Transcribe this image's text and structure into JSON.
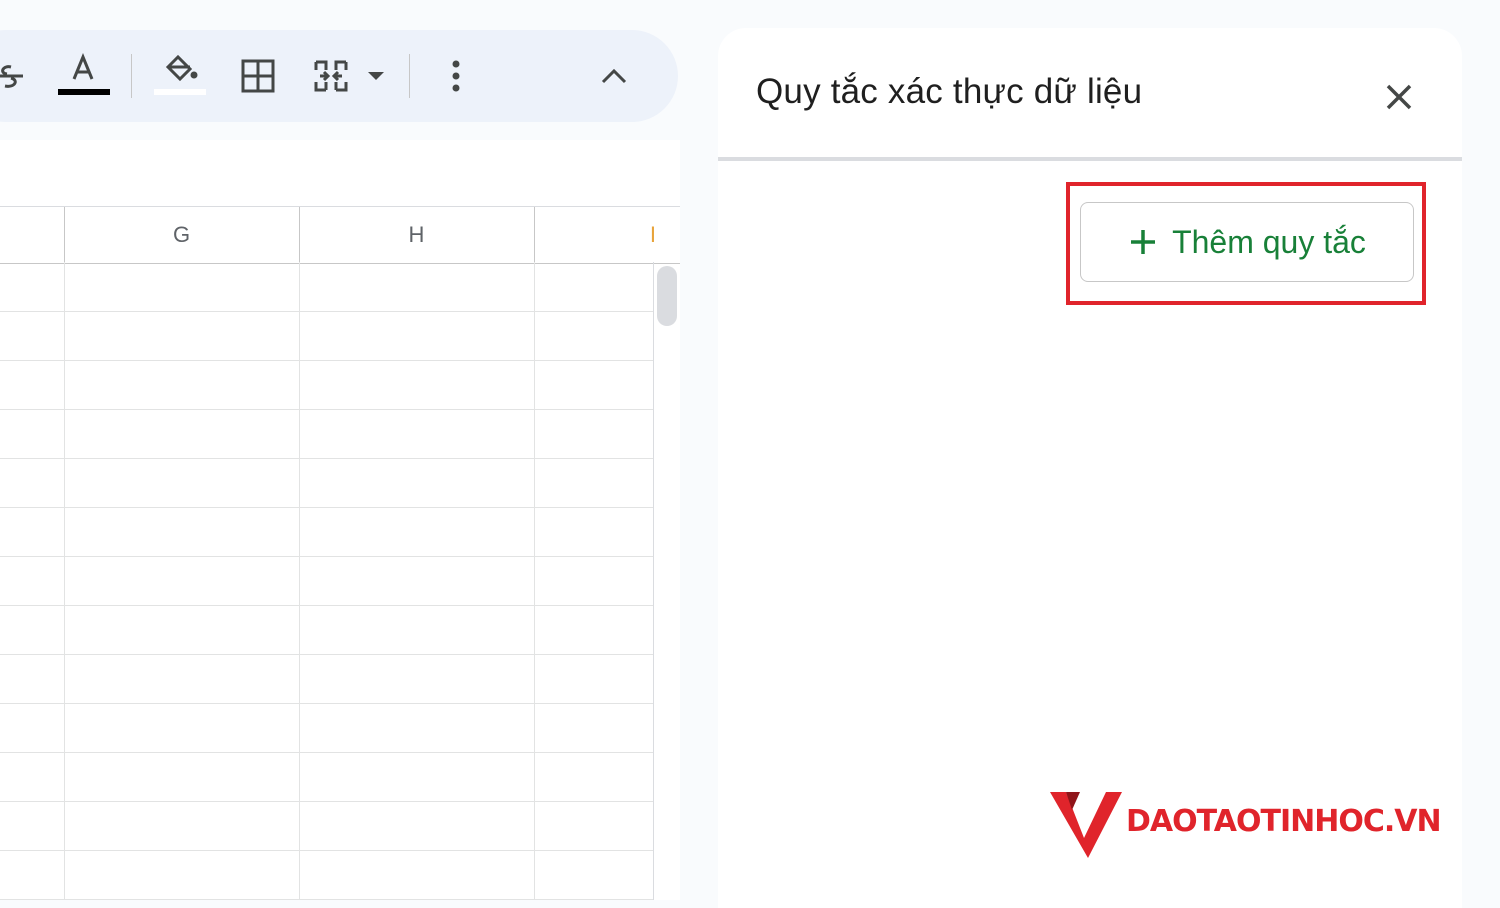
{
  "grid": {
    "columns": [
      "G",
      "H",
      "I"
    ]
  },
  "panel": {
    "title": "Quy tắc xác thực dữ liệu",
    "add_rule_label": "Thêm quy tắc"
  },
  "logo": {
    "text": "DAOTAOTINHOC.VN"
  },
  "icons": {
    "strikethrough": "strikethrough-icon",
    "text_color": "text-color-icon",
    "fill_color": "fill-color-icon",
    "borders": "borders-icon",
    "merge": "merge-cells-icon",
    "more": "more-vert-icon",
    "collapse": "chevron-up-icon",
    "close": "close-icon",
    "add": "plus-icon"
  },
  "colors": {
    "accent_green": "#188038",
    "highlight_red": "#e0242b",
    "toolbar_bg": "#edf2fa"
  }
}
